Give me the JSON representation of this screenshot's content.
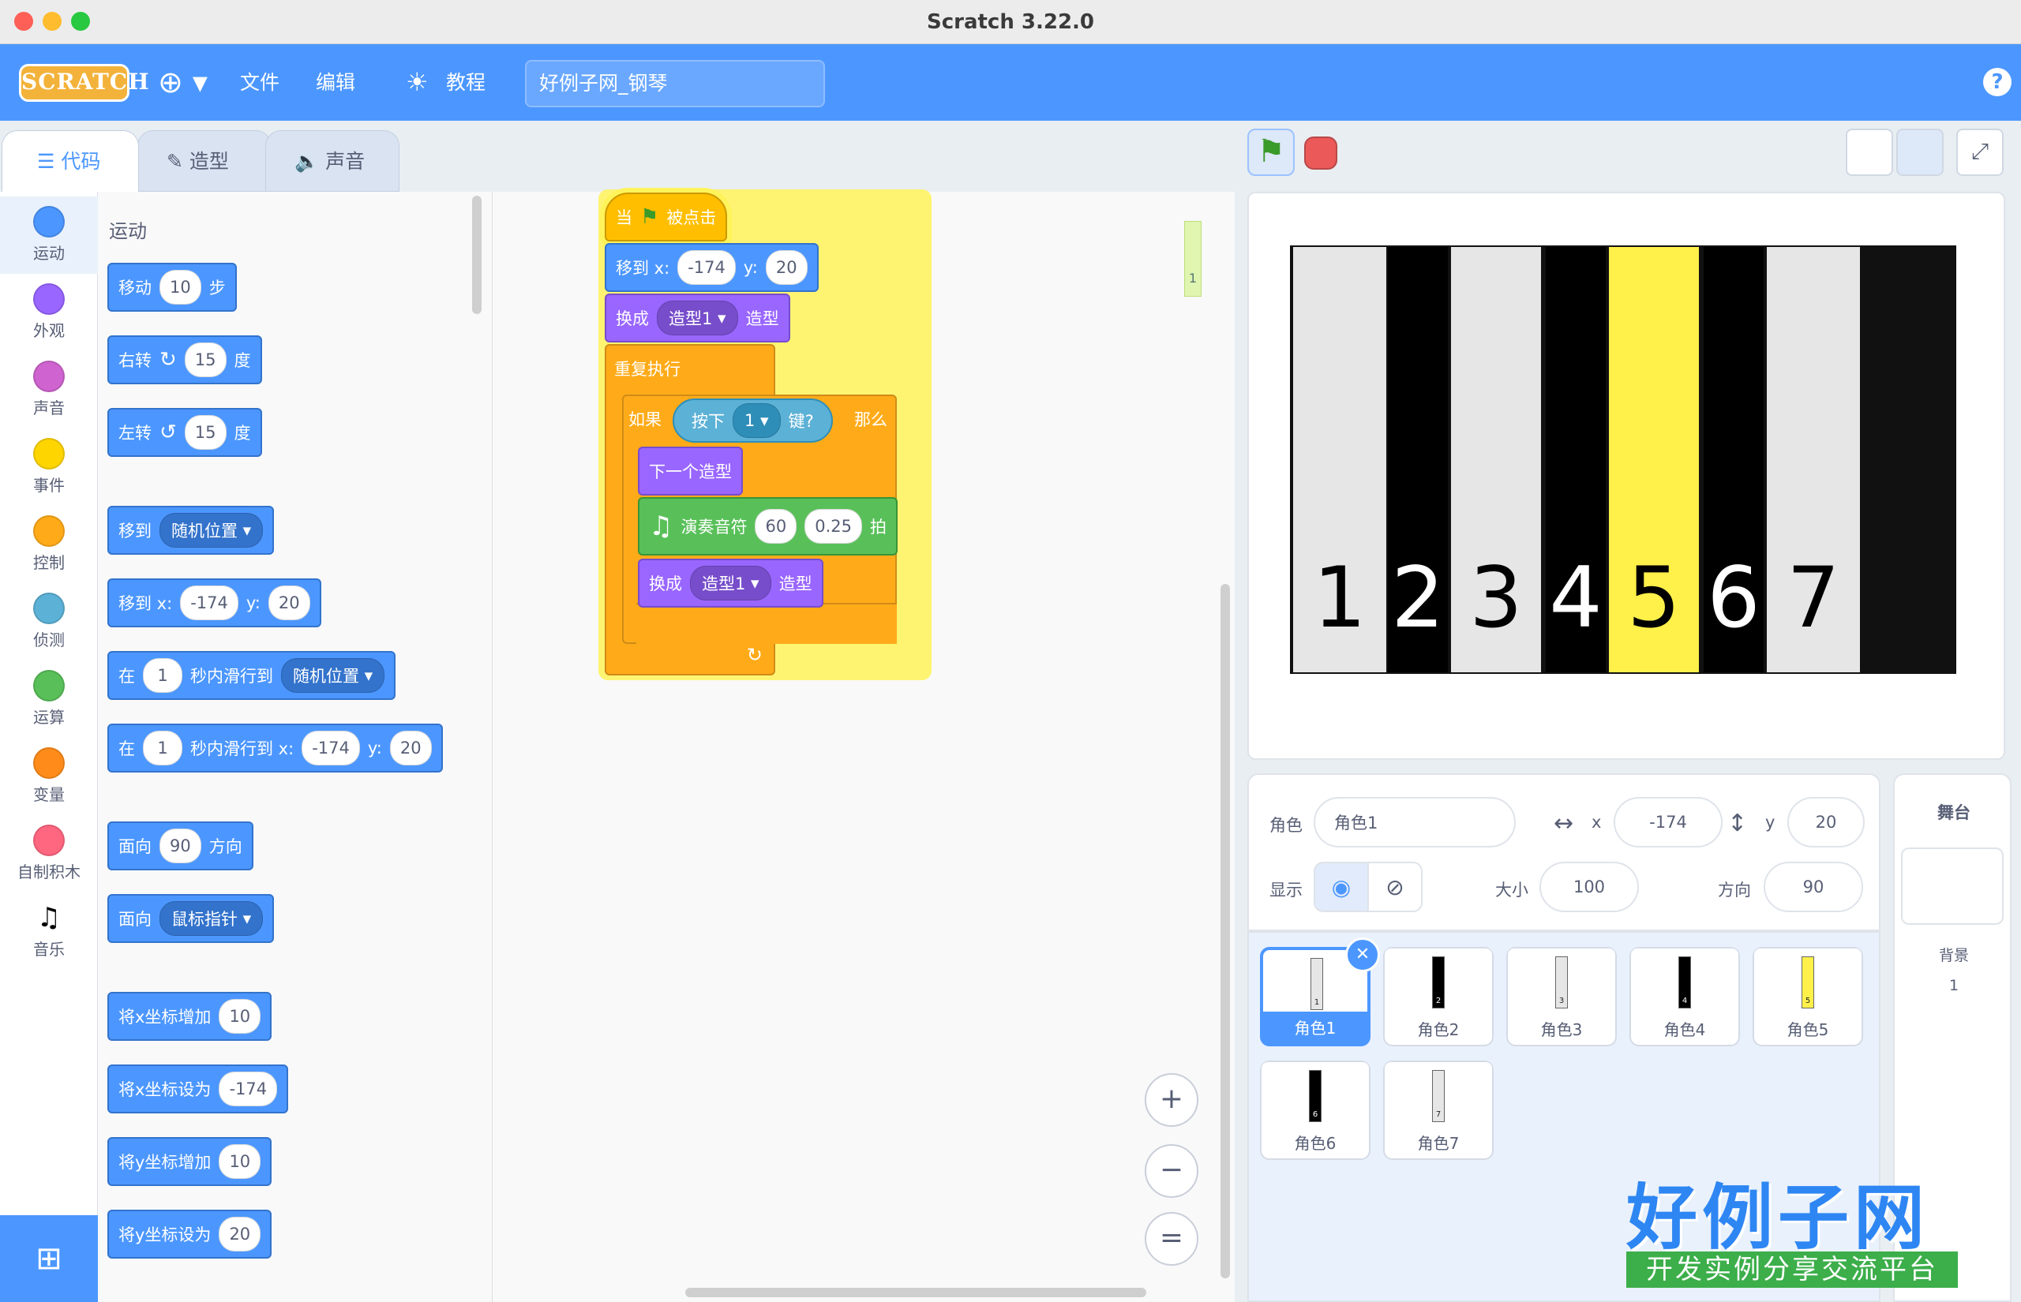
{
  "window": {
    "title": "Scratch 3.22.0"
  },
  "menu": {
    "logo": "SCRATCH",
    "file": "文件",
    "edit": "编辑",
    "tutorials": "教程",
    "project_title": "好例子网_钢琴",
    "help": "?"
  },
  "tabs": {
    "code": "代码",
    "costumes": "造型",
    "sounds": "声音"
  },
  "categories": [
    {
      "label": "运动",
      "color": "#4c97ff"
    },
    {
      "label": "外观",
      "color": "#9966ff"
    },
    {
      "label": "声音",
      "color": "#cf63cf"
    },
    {
      "label": "事件",
      "color": "#ffd500"
    },
    {
      "label": "控制",
      "color": "#ffab19"
    },
    {
      "label": "侦测",
      "color": "#5cb1d6"
    },
    {
      "label": "运算",
      "color": "#59c059"
    },
    {
      "label": "变量",
      "color": "#ff8c1a"
    },
    {
      "label": "自制积木",
      "color": "#ff6680"
    },
    {
      "label": "音乐",
      "color": ""
    }
  ],
  "palette": {
    "heading": "运动",
    "move": {
      "a": "移动",
      "v": "10",
      "b": "步"
    },
    "turn_right": {
      "a": "右转",
      "v": "15",
      "b": "度"
    },
    "turn_left": {
      "a": "左转",
      "v": "15",
      "b": "度"
    },
    "goto": {
      "a": "移到",
      "d": "随机位置"
    },
    "goto_xy": {
      "a": "移到 x:",
      "x": "-174",
      "b": "y:",
      "y": "20"
    },
    "glide": {
      "a": "在",
      "v": "1",
      "b": "秒内滑行到",
      "d": "随机位置"
    },
    "glide_xy": {
      "a": "在",
      "v": "1",
      "b": "秒内滑行到 x:",
      "x": "-174",
      "c": "y:",
      "y": "20"
    },
    "point_dir": {
      "a": "面向",
      "v": "90",
      "b": "方向"
    },
    "point_towards": {
      "a": "面向",
      "d": "鼠标指针"
    },
    "change_x": {
      "a": "将x坐标增加",
      "v": "10"
    },
    "set_x": {
      "a": "将x坐标设为",
      "v": "-174"
    },
    "change_y": {
      "a": "将y坐标增加",
      "v": "10"
    },
    "set_y": {
      "a": "将y坐标设为",
      "v": "20"
    }
  },
  "script": {
    "hat": {
      "a": "当",
      "b": "被点击"
    },
    "goto": {
      "a": "移到 x:",
      "x": "-174",
      "b": "y:",
      "y": "20"
    },
    "switch1": {
      "a": "换成",
      "d": "造型1",
      "b": "造型"
    },
    "forever": "重复执行",
    "if": {
      "a": "如果",
      "b": "那么"
    },
    "keypressed": {
      "a": "按下",
      "d": "1",
      "b": "键?"
    },
    "next": "下一个造型",
    "play": {
      "a": "演奏音符",
      "n": "60",
      "t": "0.25",
      "b": "拍"
    },
    "switch2": {
      "a": "换成",
      "d": "造型1",
      "b": "造型"
    },
    "minimap": "1"
  },
  "zoom": {
    "in": "+",
    "out": "−",
    "reset": "="
  },
  "stage": {
    "keys": [
      {
        "label": "1",
        "bg": "#e6e6e6",
        "fg": "#000000"
      },
      {
        "label": "2",
        "bg": "#000000",
        "fg": "#ffffff"
      },
      {
        "label": "3",
        "bg": "#e6e6e6",
        "fg": "#000000"
      },
      {
        "label": "4",
        "bg": "#000000",
        "fg": "#ffffff"
      },
      {
        "label": "5",
        "bg": "#fff04a",
        "fg": "#000000"
      },
      {
        "label": "6",
        "bg": "#000000",
        "fg": "#ffffff"
      },
      {
        "label": "7",
        "bg": "#e6e6e6",
        "fg": "#000000"
      }
    ]
  },
  "sprite_info": {
    "sprite_label": "角色",
    "sprite_name": "角色1",
    "x_label": "x",
    "x": "-174",
    "y_label": "y",
    "y": "20",
    "show_label": "显示",
    "size_label": "大小",
    "size": "100",
    "dir_label": "方向",
    "dir": "90"
  },
  "sprites": [
    {
      "name": "角色1",
      "num": "1",
      "color": "#e6e6e6"
    },
    {
      "name": "角色2",
      "num": "2",
      "color": "#000000"
    },
    {
      "name": "角色3",
      "num": "3",
      "color": "#e6e6e6"
    },
    {
      "name": "角色4",
      "num": "4",
      "color": "#000000"
    },
    {
      "name": "角色5",
      "num": "5",
      "color": "#fff04a"
    },
    {
      "name": "角色6",
      "num": "6",
      "color": "#000000"
    },
    {
      "name": "角色7",
      "num": "7",
      "color": "#e6e6e6"
    }
  ],
  "stage_panel": {
    "title": "舞台",
    "backdrop_label": "背景",
    "backdrop_count": "1"
  },
  "watermark": {
    "main": "好例子网",
    "sub": "开发实例分享交流平台"
  }
}
